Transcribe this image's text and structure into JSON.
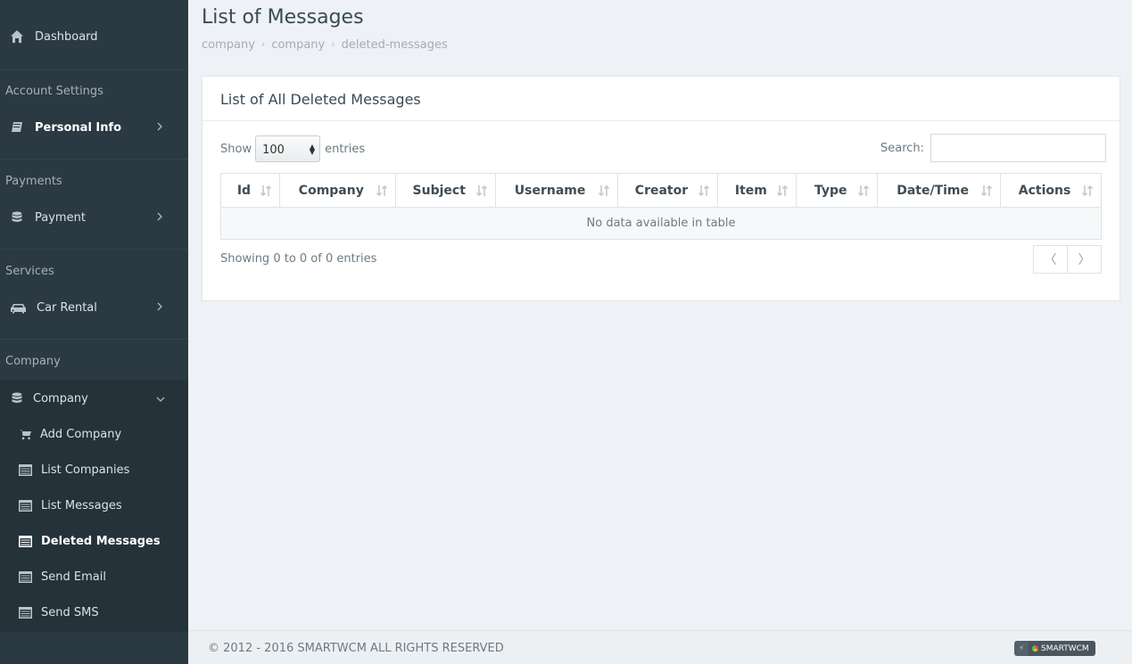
{
  "sidebar": {
    "dashboard": "Dashboard",
    "account_settings_header": "Account Settings",
    "personal_info": "Personal Info",
    "payments_header": "Payments",
    "payment": "Payment",
    "services_header": "Services",
    "car_rental": "Car Rental",
    "company_header": "Company",
    "company": "Company",
    "sub_items": [
      {
        "label": "Add Company"
      },
      {
        "label": "List Companies"
      },
      {
        "label": "List Messages"
      },
      {
        "label": "Deleted Messages"
      },
      {
        "label": "Send Email"
      },
      {
        "label": "Send SMS"
      }
    ]
  },
  "page": {
    "title": "List of Messages",
    "breadcrumb": [
      "company",
      "company",
      "deleted-messages"
    ]
  },
  "panel": {
    "title": "List of All Deleted Messages",
    "show_label": "Show",
    "page_size": "100",
    "entries_label": "entries",
    "search_label": "Search:",
    "search_value": "",
    "columns": [
      "Id",
      "Company",
      "Subject",
      "Username",
      "Creator",
      "Item",
      "Type",
      "Date/Time",
      "Actions"
    ],
    "empty_text": "No data available in table",
    "info_text": "Showing 0 to 0 of 0 entries",
    "prev": "〈",
    "next": "〉"
  },
  "footer": {
    "copyright": "© 2012 - 2016 SMARTWCM ALL RIGHTS RESERVED",
    "badge_text": "SMARTWCM"
  },
  "icons": {
    "dashboard": "home-icon",
    "personal_info": "book-icon",
    "payment": "database-icon",
    "car_rental": "car-icon",
    "company": "database-icon",
    "add_company": "cart-icon",
    "list": "list-icon"
  },
  "colors": {
    "sidebar_bg": "#2b3942",
    "sidebar_sub_bg": "#25323a",
    "main_bg": "#eef1f5",
    "panel_bg": "#ffffff"
  }
}
